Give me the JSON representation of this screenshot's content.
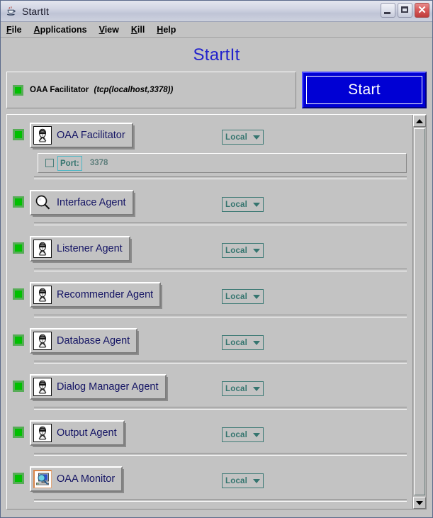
{
  "window": {
    "title": "StartIt",
    "title_icon": "java-coffee-cup-icon",
    "controls": {
      "minimize": "minimize-button",
      "maximize": "maximize-button",
      "close_glyph": "✕"
    }
  },
  "menubar": {
    "items": [
      {
        "mnemonic": "F",
        "rest": "ile"
      },
      {
        "mnemonic": "A",
        "rest": "pplications"
      },
      {
        "mnemonic": "V",
        "rest": "iew"
      },
      {
        "mnemonic": "K",
        "rest": "ill"
      },
      {
        "mnemonic": "H",
        "rest": "elp"
      }
    ]
  },
  "heading": "StartIt",
  "status": {
    "led_color": "#00c000",
    "name": "OAA Facilitator",
    "address": "(tcp(localhost,3378))"
  },
  "start_button": {
    "label": "Start",
    "color": "#0000d4"
  },
  "agents": [
    {
      "led_color": "#00c000",
      "icon": "agent-face-icon",
      "label": "OAA Facilitator",
      "location": "Local",
      "has_port_panel": true,
      "port": {
        "checkbox_checked": false,
        "label": "Port:",
        "value": "3378"
      }
    },
    {
      "led_color": "#00c000",
      "icon": "magnifier-icon",
      "label": "Interface Agent",
      "location": "Local",
      "has_port_panel": false
    },
    {
      "led_color": "#00c000",
      "icon": "agent-face-icon",
      "label": "Listener Agent",
      "location": "Local",
      "has_port_panel": false
    },
    {
      "led_color": "#00c000",
      "icon": "agent-face-icon",
      "label": "Recommender Agent",
      "location": "Local",
      "has_port_panel": false
    },
    {
      "led_color": "#00c000",
      "icon": "agent-face-icon",
      "label": "Database Agent",
      "location": "Local",
      "has_port_panel": false
    },
    {
      "led_color": "#00c000",
      "icon": "agent-face-icon",
      "label": "Dialog Manager Agent",
      "location": "Local",
      "has_port_panel": false
    },
    {
      "led_color": "#00c000",
      "icon": "agent-face-icon",
      "label": "Output Agent",
      "location": "Local",
      "has_port_panel": false
    },
    {
      "led_color": "#00c000",
      "icon": "monitor-magnifier-icon",
      "label": "OAA Monitor",
      "location": "Local",
      "has_port_panel": false
    }
  ],
  "scrollbar": {
    "up_icon": "scroll-up-arrow-icon",
    "down_icon": "scroll-down-arrow-icon"
  }
}
